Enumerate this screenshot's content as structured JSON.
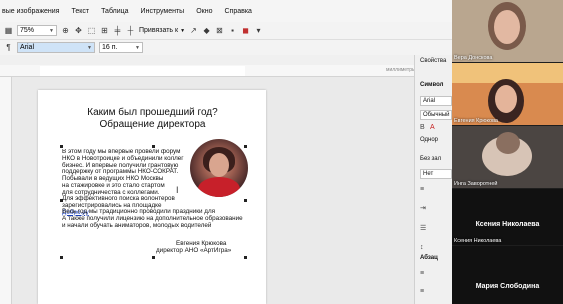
{
  "menu": [
    "вые изображения",
    "Текст",
    "Таблица",
    "Инструменты",
    "Окно",
    "Справка"
  ],
  "toolbar": {
    "zoom_value": "75%",
    "snap_label": "Привязать к",
    "font_name": "Arial",
    "font_size": "16 п."
  },
  "ruler": {
    "unit_label": "миллиметры"
  },
  "slide": {
    "title_line1": "Каким был прошедший год?",
    "title_line2": "Обращение директора",
    "lines": [
      "В этом году мы впервые провели форум",
      "НКО в Новотроицке и объединили коллег",
      "бизнес. И впервые получили грантовую",
      "поддержку от программы НКО-СОКРАТ.",
      "Побывали в ведущих НКО Москвы",
      "на стажировке и это стало стартом",
      "для сотрудничества с коллегами.",
      "Для эффективного поиска волонтеров",
      "зарегистрировались на площадке",
      "Добро.ру"
    ],
    "lines_wide": [
      "Весь год мы традиционно проводили праздники для",
      "А также получили лицензию на дополнительное образование",
      "и начали обучать аниматоров, молодых водителей"
    ],
    "signature_name": "Евгения Крюкова",
    "signature_role": "директор АНО «АртИгра»"
  },
  "sidebar": {
    "properties_label": "Свойства",
    "symbol_label": "Символ",
    "font_value": "Arial",
    "style_value": "Обычный",
    "single_label": "Однор",
    "no_fill_label": "Без зал",
    "none_value": "Нет",
    "paragraph_label": "Абзац"
  },
  "video": {
    "participants": [
      {
        "name": "Вера Донскова"
      },
      {
        "name": "Евгения Крюкова"
      },
      {
        "name": "Инга Заворотней"
      },
      {
        "name": "Ксения Николаева",
        "big_label": "Ксения Николаева"
      },
      {
        "name": "Мария Слободина",
        "big_label": "Мария Слободина"
      }
    ]
  }
}
